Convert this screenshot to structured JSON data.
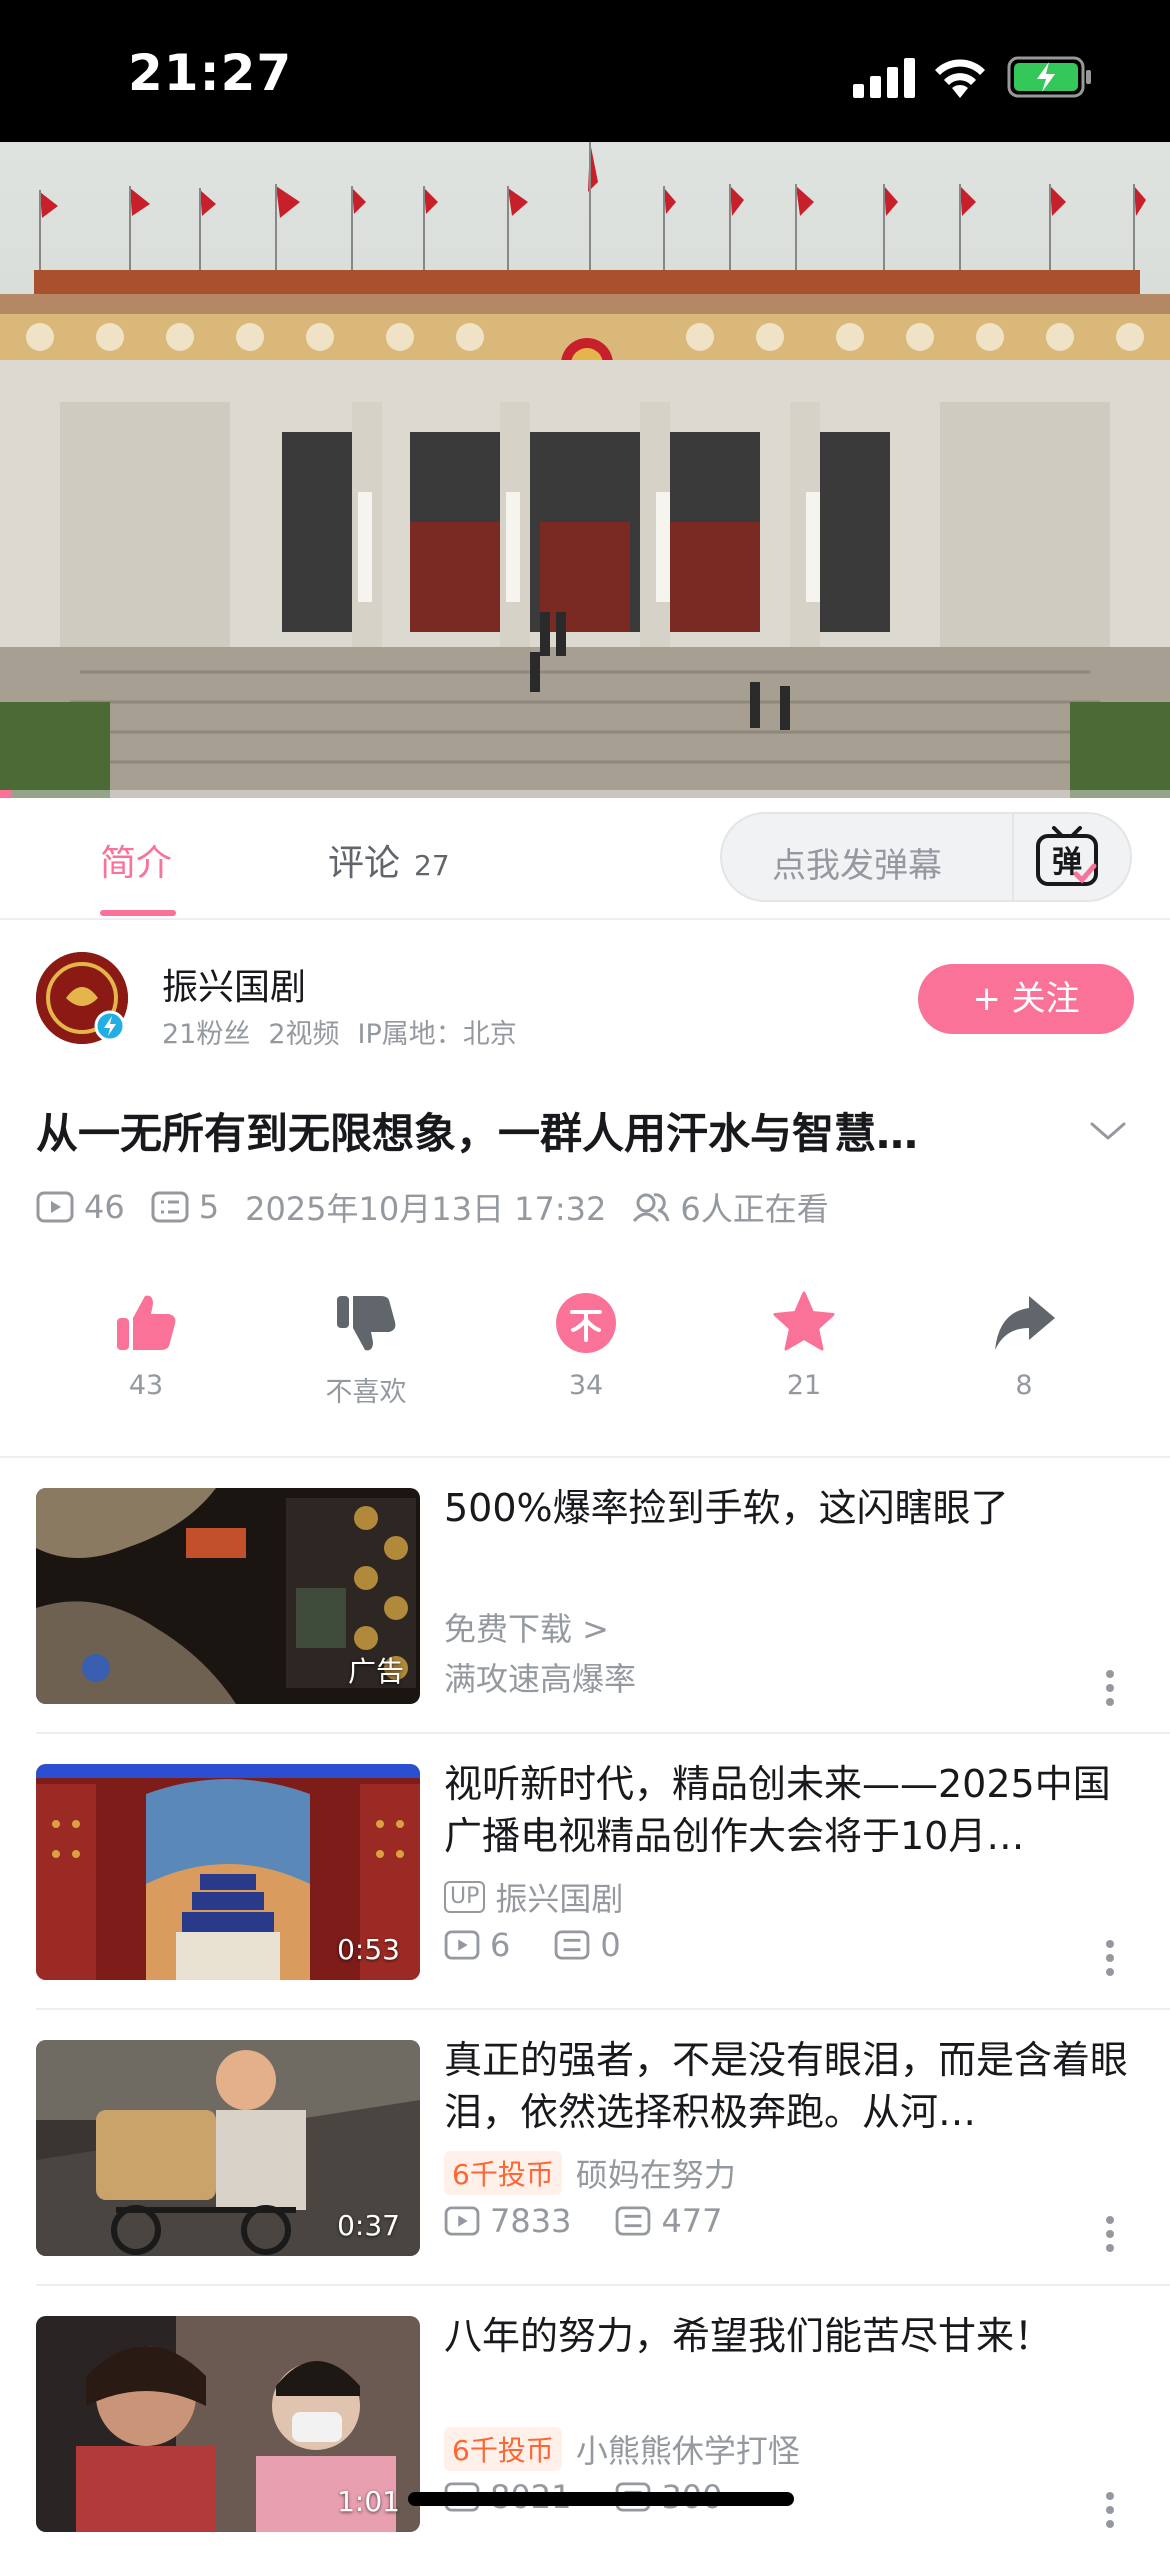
{
  "status_bar": {
    "time": "21:27"
  },
  "tabs": {
    "intro": "简介",
    "comments": "评论",
    "comments_count": "27",
    "danmaku_placeholder": "点我发弹幕",
    "danmaku_button": "弹"
  },
  "uploader": {
    "name": "振兴国剧",
    "followers": "21粉丝",
    "videos": "2视频",
    "ip": "IP属地：北京",
    "follow_label": "+ 关注"
  },
  "video": {
    "title": "从一无所有到无限想象，一群人用汗水与智慧…",
    "plays": "46",
    "danmaku": "5",
    "datetime": "2025年10月13日 17:32",
    "watching": "6人正在看",
    "progress": 0.01
  },
  "actions": {
    "like": "43",
    "dislike": "不喜欢",
    "coin": "34",
    "favorite": "21",
    "share": "8"
  },
  "recommendations": [
    {
      "title": "500%爆率捡到手软，这闪瞎眼了",
      "line1": "免费下载 >",
      "line2": "满攻速高爆率",
      "ad_label": "广告"
    },
    {
      "title": "视听新时代，精品创未来——2025中国广播电视精品创作大会将于10月…",
      "up_tag": "UP",
      "uploader": "振兴国剧",
      "plays": "6",
      "danmaku": "0",
      "duration": "0:53"
    },
    {
      "title": "真正的强者，不是没有眼泪，而是含着眼泪，依然选择积极奔跑。从河…",
      "badge": "6千投币",
      "uploader": "硕妈在努力",
      "plays": "7833",
      "danmaku": "477",
      "duration": "0:37"
    },
    {
      "title": "八年的努力，希望我们能苦尽甘来！",
      "badge": "6千投币",
      "uploader": "小熊熊休学打怪",
      "plays": "8021",
      "danmaku": "300",
      "duration": "1:01"
    }
  ],
  "colors": {
    "accent": "#fb7299",
    "text_secondary": "#9499a0",
    "coin_tag": "#ff6633"
  }
}
